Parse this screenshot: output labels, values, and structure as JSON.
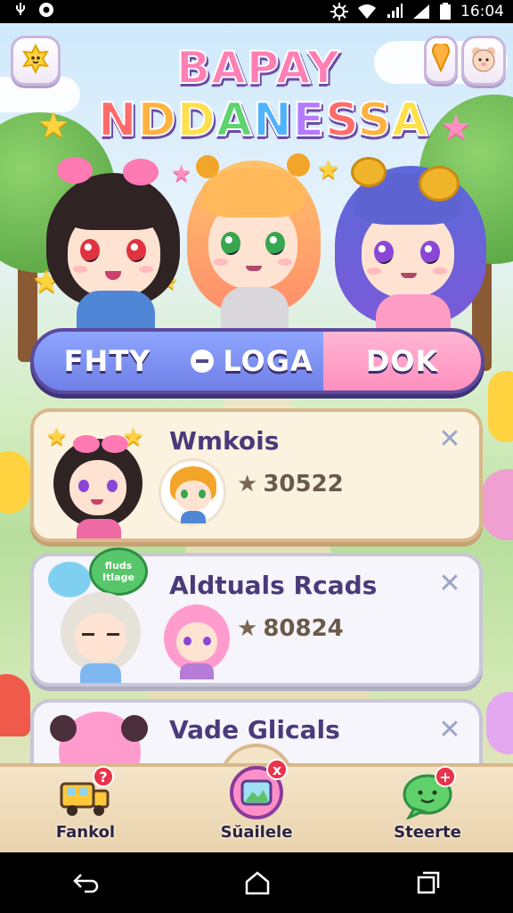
{
  "status_bar": {
    "time": "16:04"
  },
  "header": {
    "logo_line1": "BAPAY",
    "logo_line2": "NDDANESSA"
  },
  "tabs": [
    {
      "label": "FHTY"
    },
    {
      "label": "LOGA"
    },
    {
      "label": "DOK"
    }
  ],
  "cards": [
    {
      "title": "Wmkois",
      "score": "30522"
    },
    {
      "title": "Aldtuals Rcads",
      "score": "80824",
      "bubble_text": "fluds Itlage"
    },
    {
      "title": "Vade Glicals"
    }
  ],
  "bottom_nav": [
    {
      "label": "Fankol",
      "badge": "?"
    },
    {
      "label": "Sŭailele",
      "badge": "x"
    },
    {
      "label": "Steerte",
      "badge": "+"
    }
  ],
  "icons": {
    "left_corner": "sun-face-icon",
    "right_corner_1": "pin-icon",
    "right_corner_2": "bear-face-icon",
    "nav_1": "truck-icon",
    "nav_2": "photo-frame-icon",
    "nav_3": "chat-bubble-icon"
  },
  "colors": {
    "tab_blue": "#7c8ff0",
    "tab_pink": "#ff9cc4",
    "card_border": "#d9b88b",
    "title_text": "#4b3a7a",
    "badge_red": "#e8334a"
  }
}
